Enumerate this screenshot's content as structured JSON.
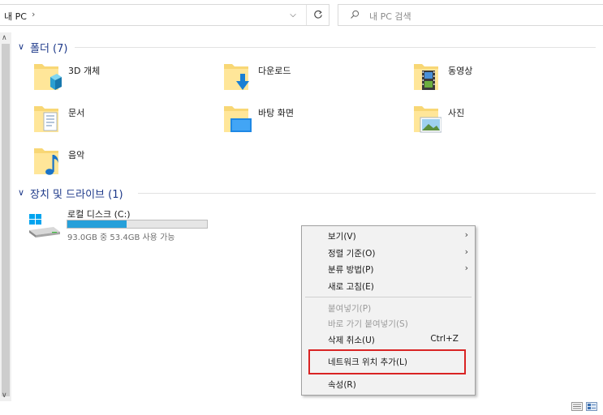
{
  "address_bar": {
    "location": "내 PC",
    "separator": "›",
    "dropdown_glyph": "⌵"
  },
  "search": {
    "placeholder": "내 PC 검색"
  },
  "sections": {
    "folders": {
      "title": "폴더 (7)"
    },
    "devices": {
      "title": "장치 및 드라이브 (1)"
    }
  },
  "folders": [
    {
      "label": "3D 개체",
      "icon": "3d-objects-icon"
    },
    {
      "label": "다운로드",
      "icon": "downloads-icon"
    },
    {
      "label": "동영상",
      "icon": "videos-icon"
    },
    {
      "label": "문서",
      "icon": "documents-icon"
    },
    {
      "label": "바탕 화면",
      "icon": "desktop-icon"
    },
    {
      "label": "사진",
      "icon": "pictures-icon"
    },
    {
      "label": "음악",
      "icon": "music-icon"
    }
  ],
  "drive": {
    "name": "로컬 디스크 (C:)",
    "space_text": "93.0GB 중 53.4GB 사용 가능",
    "used_fraction": 0.426,
    "bar_color": "#26a0da"
  },
  "context_menu": {
    "items": [
      {
        "label": "보기(V)",
        "submenu": true,
        "disabled": false
      },
      {
        "label": "정렬 기준(O)",
        "submenu": true,
        "disabled": false
      },
      {
        "label": "분류 방법(P)",
        "submenu": true,
        "disabled": false
      },
      {
        "label": "새로 고침(E)",
        "submenu": false,
        "disabled": false
      },
      {
        "label": "붙여넣기(P)",
        "submenu": false,
        "disabled": true
      },
      {
        "label": "바로 가기 붙여넣기(S)",
        "submenu": false,
        "disabled": true
      },
      {
        "label": "삭제 취소(U)",
        "shortcut": "Ctrl+Z",
        "submenu": false,
        "disabled": false
      },
      {
        "label": "네트워크 위치 추가(L)",
        "submenu": false,
        "disabled": false,
        "highlighted": true
      },
      {
        "label": "속성(R)",
        "submenu": false,
        "disabled": false
      }
    ],
    "submenu_arrow": "›"
  },
  "colors": {
    "accent": "#1e3a8a",
    "highlight_border": "#d92424",
    "folder_yellow": "#f8d775"
  }
}
